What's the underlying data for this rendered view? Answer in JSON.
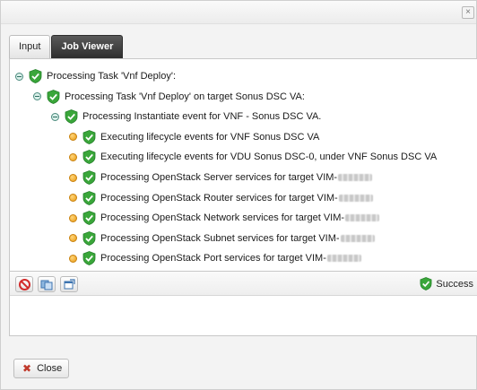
{
  "window": {
    "close_glyph": "×"
  },
  "tabs": [
    {
      "label": "Input",
      "active": false
    },
    {
      "label": "Job Viewer",
      "active": true
    }
  ],
  "tree": [
    {
      "level": 0,
      "marker": "toggle",
      "label": "Processing Task 'Vnf Deploy':",
      "masked": false
    },
    {
      "level": 1,
      "marker": "toggle",
      "label": "Processing Task 'Vnf Deploy' on target Sonus DSC VA:",
      "masked": false
    },
    {
      "level": 2,
      "marker": "toggle",
      "label": "Processing Instantiate event for VNF - Sonus DSC VA.",
      "masked": false
    },
    {
      "level": 3,
      "marker": "bullet",
      "label": "Executing lifecycle events for VNF Sonus DSC VA",
      "masked": false
    },
    {
      "level": 3,
      "marker": "bullet",
      "label": "Executing lifecycle events for VDU Sonus DSC-0, under VNF Sonus DSC VA",
      "masked": false
    },
    {
      "level": 3,
      "marker": "bullet",
      "label": "Processing OpenStack Server services for target VIM-",
      "masked": true
    },
    {
      "level": 3,
      "marker": "bullet",
      "label": "Processing OpenStack Router services for target VIM-",
      "masked": true
    },
    {
      "level": 3,
      "marker": "bullet",
      "label": "Processing OpenStack Network services for target VIM-",
      "masked": true
    },
    {
      "level": 3,
      "marker": "bullet",
      "label": "Processing OpenStack Subnet services for target VIM-",
      "masked": true
    },
    {
      "level": 3,
      "marker": "bullet",
      "label": "Processing OpenStack Port services for target VIM-",
      "masked": true
    }
  ],
  "toolbar": {
    "buttons": [
      "stop-icon",
      "refresh-icon",
      "popout-icon"
    ]
  },
  "status": {
    "label": "Success"
  },
  "footer": {
    "close_label": "Close"
  },
  "colors": {
    "success_green": "#3aa63a",
    "tab_active": "#3a3a3a",
    "stop_red": "#d22a2a"
  }
}
